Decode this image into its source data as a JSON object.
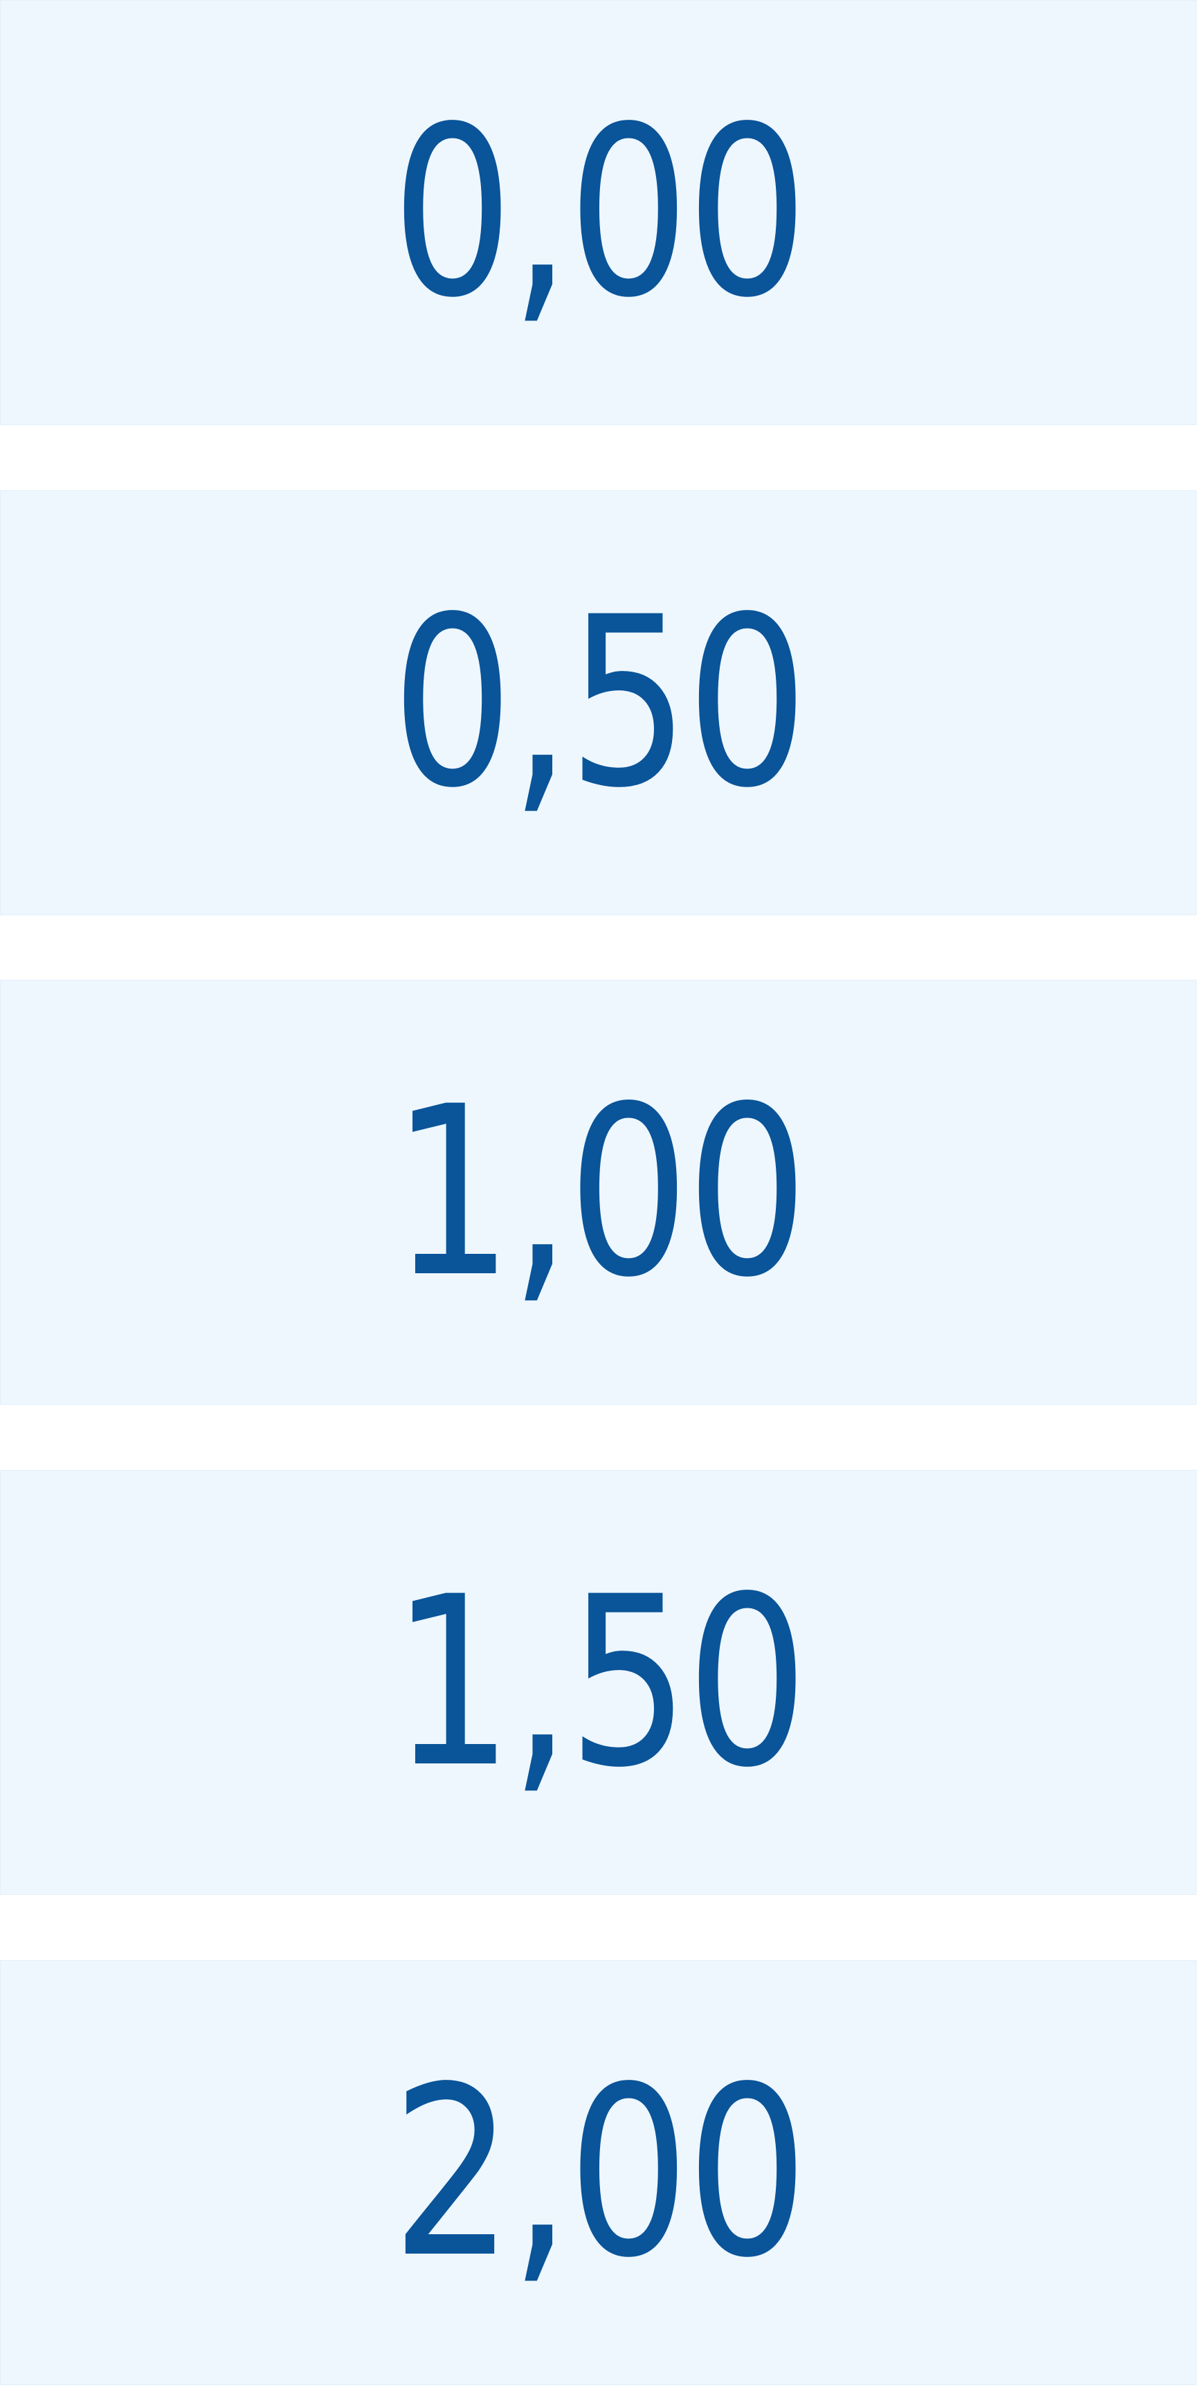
{
  "options": [
    {
      "label": "0,00"
    },
    {
      "label": "0,50"
    },
    {
      "label": "1,00"
    },
    {
      "label": "1,50"
    },
    {
      "label": "2,00"
    }
  ],
  "colors": {
    "tile_background": "#eef7fe",
    "text": "#0a5499",
    "gap": "#ffffff"
  }
}
